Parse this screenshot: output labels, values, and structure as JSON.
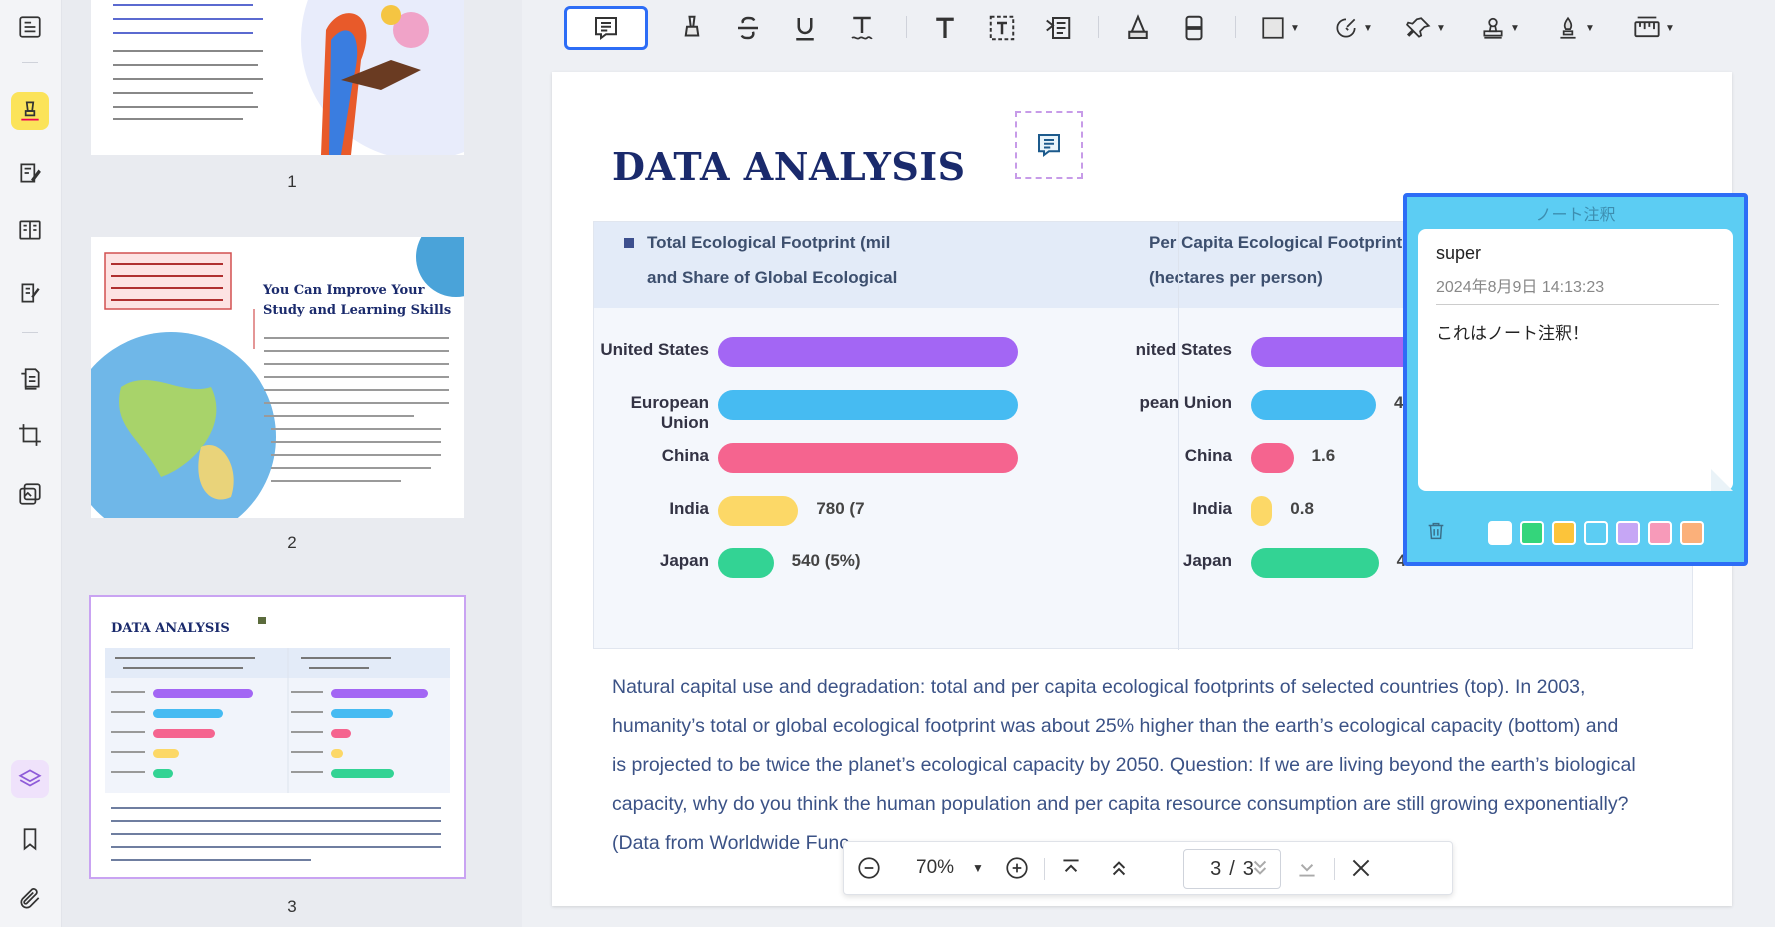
{
  "colors": {
    "accent": "#2d6df6",
    "note_popup_bg": "#5ccdf3",
    "title_navy": "#1a2a6c",
    "caption_blue": "#3b5286",
    "purple": "#a366f4",
    "blue": "#46bbf2",
    "pink": "#f5648f",
    "yellow": "#fcd867",
    "green": "#33d394"
  },
  "rail": {
    "icons": [
      "reader-icon",
      "highlighter-icon",
      "edit-text-icon",
      "organize-pages-icon",
      "form-icon",
      "convert-icon",
      "crop-icon",
      "batch-icon",
      "layers-icon",
      "bookmark-icon",
      "attachment-icon"
    ]
  },
  "thumbnails": {
    "pages": [
      {
        "number": "1"
      },
      {
        "number": "2",
        "title": "You Can Improve Your Study and Learning Skills"
      },
      {
        "number": "3",
        "title": "DATA ANALYSIS"
      }
    ]
  },
  "toolbar": {
    "tools": [
      "sticky-note-icon",
      "highlight-icon",
      "strikethrough-icon",
      "underline-icon",
      "squiggly-icon",
      "text-icon",
      "text-box-icon",
      "text-callout-icon",
      "pencil-icon",
      "eraser-icon",
      "shape-icon",
      "shape-brush-icon",
      "pin-icon",
      "stamp-icon",
      "signature-icon",
      "measure-icon"
    ]
  },
  "document": {
    "title": "DATA ANALYSIS",
    "left_header_line1": "Total Ecological Footprint (mil",
    "left_header_line2": "and Share of Global Ecological",
    "right_header_line1": "Per Capita Ecological Footprint",
    "right_header_line2": "(hectares per person)",
    "caption_lines": [
      "Natural capital use and degradation: total and per capita ecological footprints of selected countries (top). In 2003,",
      "humanity’s total or global ecological footprint was about 25% higher than the earth’s ecological capacity (bottom) and",
      "is projected to be twice the planet’s ecological capacity by 2050. Question: If we are living beyond the earth’s biological",
      "capacity, why do you think the human population and per capita resource consumption are still growing exponentially?",
      "(Data from Worldwide Func"
    ]
  },
  "chart_data": [
    {
      "type": "bar",
      "orientation": "horizontal",
      "title": "Total Ecological Footprint (mil… and Share of Global Ecological…",
      "categories": [
        "United States",
        "European Union",
        "China",
        "India",
        "Japan"
      ],
      "visible_value_labels": [
        "",
        "",
        "",
        "780 (7",
        "540 (5%)"
      ],
      "values": [
        null,
        null,
        null,
        780,
        540
      ],
      "colors": [
        "#a366f4",
        "#46bbf2",
        "#f5648f",
        "#fcd867",
        "#33d394"
      ]
    },
    {
      "type": "bar",
      "orientation": "horizontal",
      "title": "Per Capita Ecological Footprint (hectares per person)",
      "categories": [
        "nited States",
        "pean Union",
        "China",
        "India",
        "Japan"
      ],
      "values": [
        9.7,
        4.7,
        1.6,
        0.8,
        4.8
      ],
      "colors": [
        "#a366f4",
        "#46bbf2",
        "#f5648f",
        "#fcd867",
        "#33d394"
      ]
    }
  ],
  "note_popup": {
    "title": "ノート注釈",
    "author": "super",
    "datetime": "2024年8月9日 14:13:23",
    "body": "これはノート注釈！",
    "swatches": [
      "#ffffff",
      "#34d57b",
      "#fcc43a",
      "#5ccdf3",
      "#c6a6f5",
      "#f79ab9",
      "#fbb07a"
    ]
  },
  "navbar": {
    "zoom": "70%",
    "current_page": "3",
    "separator": "/",
    "total_pages": "3"
  }
}
